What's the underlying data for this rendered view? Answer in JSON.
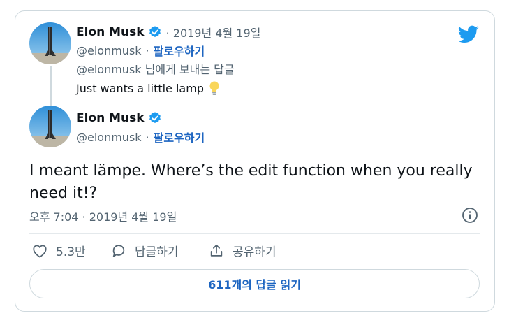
{
  "parent_tweet": {
    "author_name": "Elon Musk",
    "date": "· 2019년 4월 19일",
    "handle": "@elonmusk",
    "separator": "·",
    "follow_label": "팔로우하기",
    "replying_to": "@elonmusk 님에게 보내는 답글",
    "text": "Just wants a little lamp"
  },
  "main_tweet": {
    "author_name": "Elon Musk",
    "handle": "@elonmusk",
    "separator": "·",
    "follow_label": "팔로우하기",
    "text": "I meant lämpe. Where’s the edit function when you really need it!?",
    "timestamp": "오후 7:04 · 2019년 4월 19일"
  },
  "actions": {
    "like_count": "5.3만",
    "reply_label": "답글하기",
    "share_label": "공유하기"
  },
  "read_replies_label": "611개의 답글 읽기",
  "icons": {
    "verified": "verified-badge-icon",
    "bulb": "light-bulb-icon",
    "info": "info-icon",
    "like": "heart-icon",
    "reply": "speech-bubble-icon",
    "share": "share-icon",
    "logo": "twitter-bird-icon"
  },
  "colors": {
    "accent": "#1d9bf0",
    "link": "#1d65c1",
    "secondary_text": "#536471",
    "border": "#cfd9de"
  }
}
